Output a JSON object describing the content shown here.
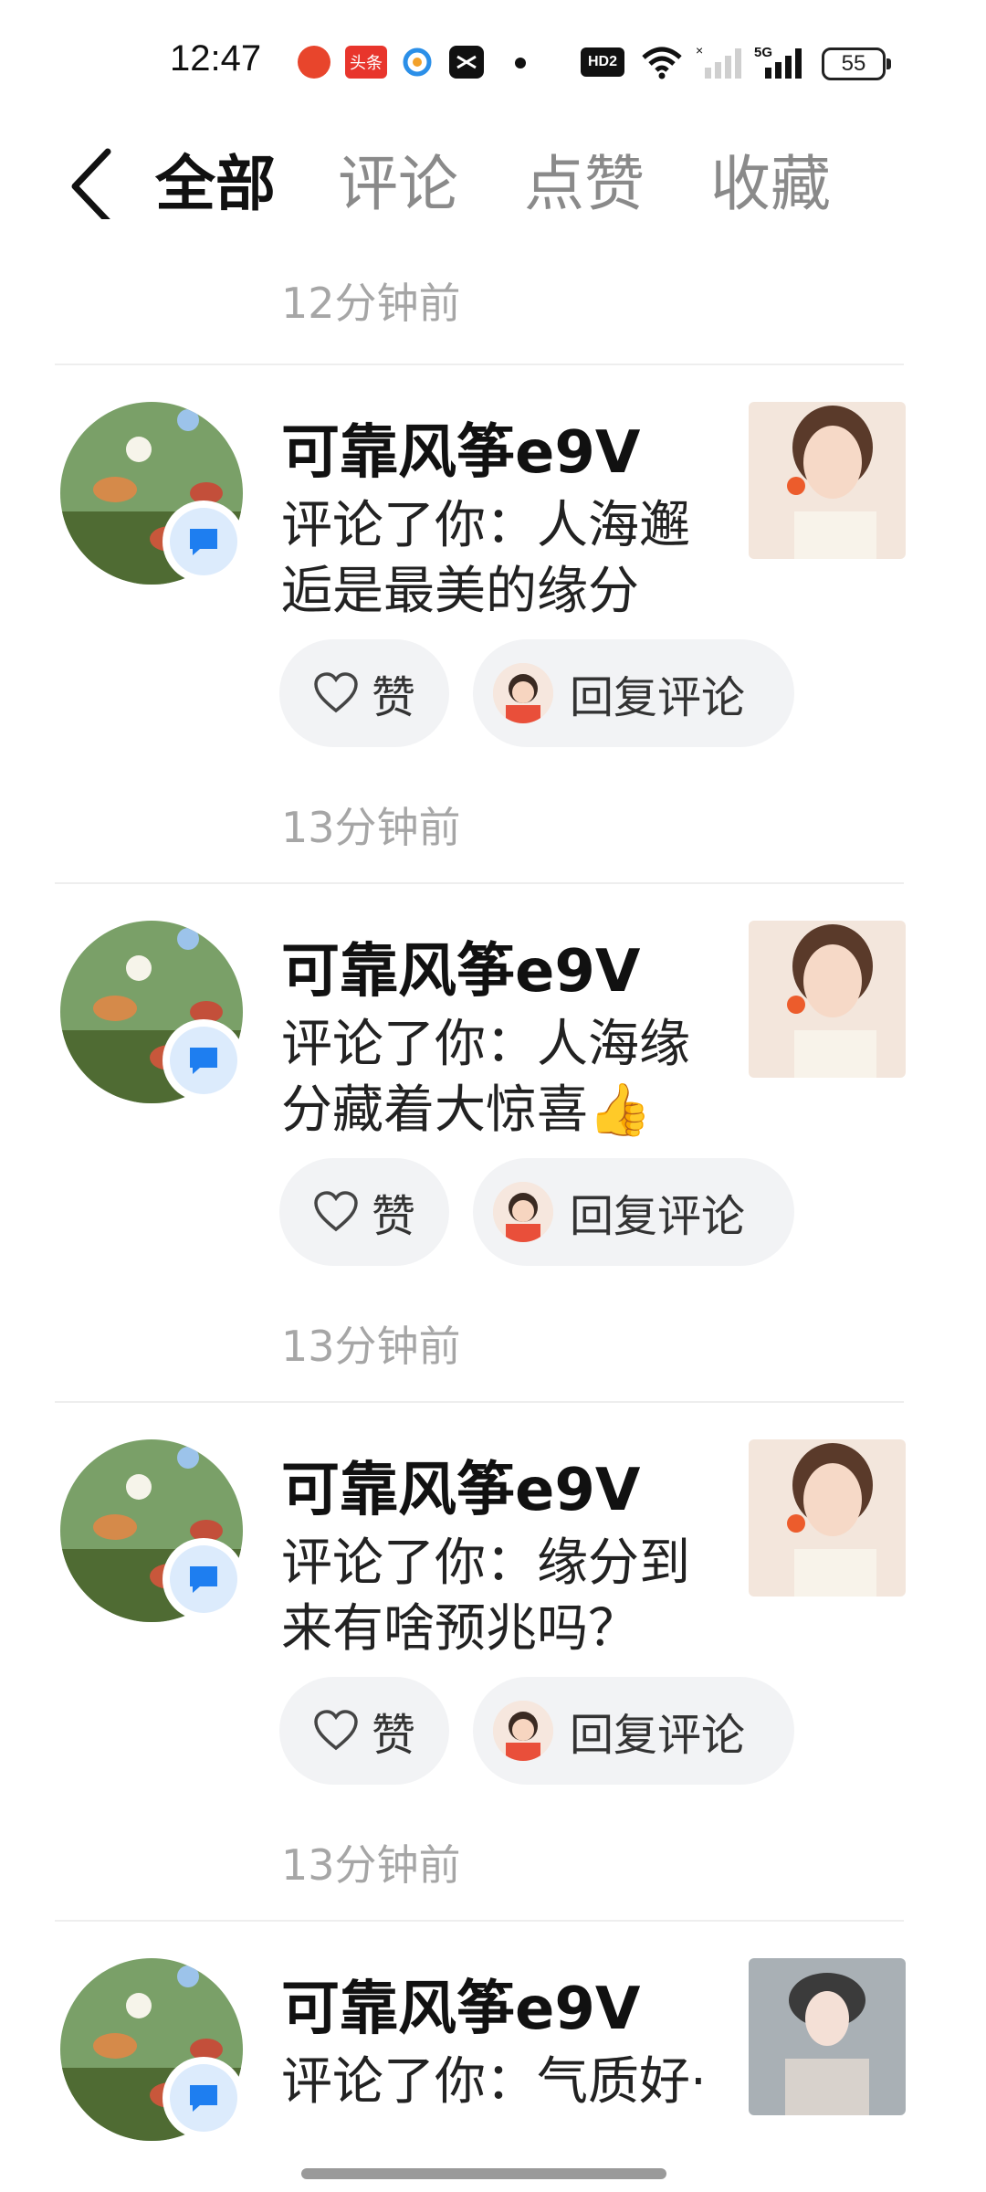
{
  "status_bar": {
    "time": "12:47",
    "app_icons": [
      "app-icon",
      "toutiao-icon",
      "app-icon",
      "capcut-icon"
    ],
    "hd_label": "HD2",
    "network_label": "5G",
    "battery": "55",
    "toutiao_text": "头条"
  },
  "header": {
    "tabs": [
      {
        "label": "全部"
      },
      {
        "label": "评论"
      },
      {
        "label": "点赞"
      },
      {
        "label": "收藏"
      }
    ]
  },
  "top_time": "12分钟前",
  "items": [
    {
      "username": "可靠风筝e9V",
      "comment": "评论了你：人海邂逅是最美的缘分",
      "like_label": "赞",
      "reply_label": "回复评论",
      "time": "13分钟前"
    },
    {
      "username": "可靠风筝e9V",
      "comment": "评论了你：人海缘分藏着大惊喜👍",
      "like_label": "赞",
      "reply_label": "回复评论",
      "time": "13分钟前"
    },
    {
      "username": "可靠风筝e9V",
      "comment": "评论了你：缘分到来有啥预兆吗？",
      "like_label": "赞",
      "reply_label": "回复评论",
      "time": "13分钟前"
    },
    {
      "username": "可靠风筝e9V",
      "comment": "评论了你：气质好·"
    }
  ]
}
